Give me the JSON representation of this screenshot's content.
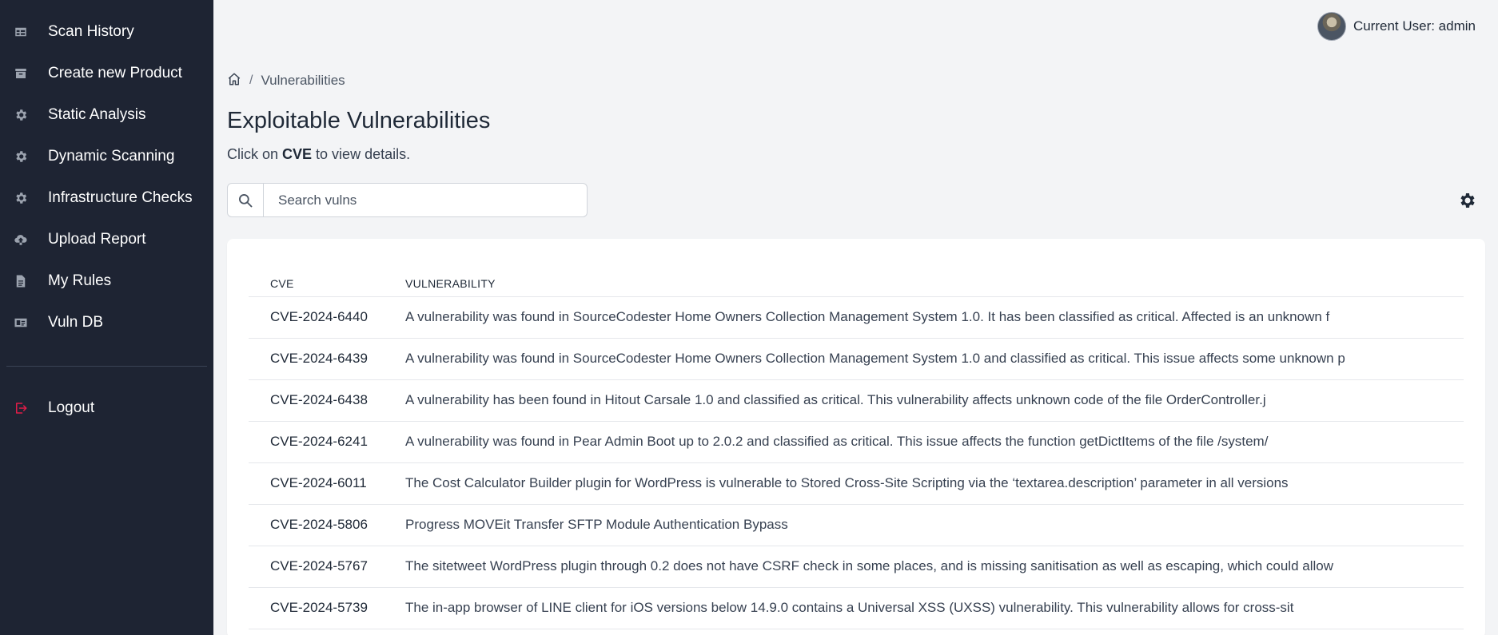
{
  "sidebar": {
    "items": [
      {
        "label": "Scan History",
        "icon": "table-icon"
      },
      {
        "label": "Create new Product",
        "icon": "archive-icon"
      },
      {
        "label": "Static Analysis",
        "icon": "gear-icon"
      },
      {
        "label": "Dynamic Scanning",
        "icon": "gear-icon"
      },
      {
        "label": "Infrastructure Checks",
        "icon": "gear-icon"
      },
      {
        "label": "Upload Report",
        "icon": "cloud-upload-icon"
      },
      {
        "label": "My Rules",
        "icon": "document-icon"
      },
      {
        "label": "Vuln DB",
        "icon": "id-card-icon"
      }
    ],
    "logout": {
      "label": "Logout",
      "icon": "logout-icon"
    }
  },
  "header": {
    "user_label": "Current User: admin"
  },
  "breadcrumb": {
    "separator": "/",
    "current": "Vulnerabilities"
  },
  "page": {
    "title": "Exploitable Vulnerabilities",
    "subtitle_prefix": "Click on ",
    "subtitle_bold": "CVE",
    "subtitle_suffix": " to view details."
  },
  "search": {
    "placeholder": "Search vulns",
    "value": ""
  },
  "table": {
    "headers": [
      "CVE",
      "VULNERABILITY"
    ],
    "rows": [
      {
        "cve": "CVE-2024-6440",
        "desc": "A vulnerability was found in SourceCodester Home Owners Collection Management System 1.0. It has been classified as critical. Affected is an unknown f"
      },
      {
        "cve": "CVE-2024-6439",
        "desc": "A vulnerability was found in SourceCodester Home Owners Collection Management System 1.0 and classified as critical. This issue affects some unknown p"
      },
      {
        "cve": "CVE-2024-6438",
        "desc": "A vulnerability has been found in Hitout Carsale 1.0 and classified as critical. This vulnerability affects unknown code of the file OrderController.j"
      },
      {
        "cve": "CVE-2024-6241",
        "desc": "A vulnerability was found in Pear Admin Boot up to 2.0.2 and classified as critical. This issue affects the function getDictItems of the file /system/"
      },
      {
        "cve": "CVE-2024-6011",
        "desc": "The Cost Calculator Builder plugin for WordPress is vulnerable to Stored Cross-Site Scripting via the ‘textarea.description’ parameter in all versions"
      },
      {
        "cve": "CVE-2024-5806",
        "desc": "Progress MOVEit Transfer SFTP Module Authentication Bypass"
      },
      {
        "cve": "CVE-2024-5767",
        "desc": "The sitetweet WordPress plugin through 0.2 does not have CSRF check in some places, and is missing sanitisation as well as escaping, which could allow"
      },
      {
        "cve": "CVE-2024-5739",
        "desc": "The in-app browser of LINE client for iOS versions below 14.9.0 contains a Universal XSS (UXSS) vulnerability. This vulnerability allows for cross-sit"
      }
    ]
  }
}
